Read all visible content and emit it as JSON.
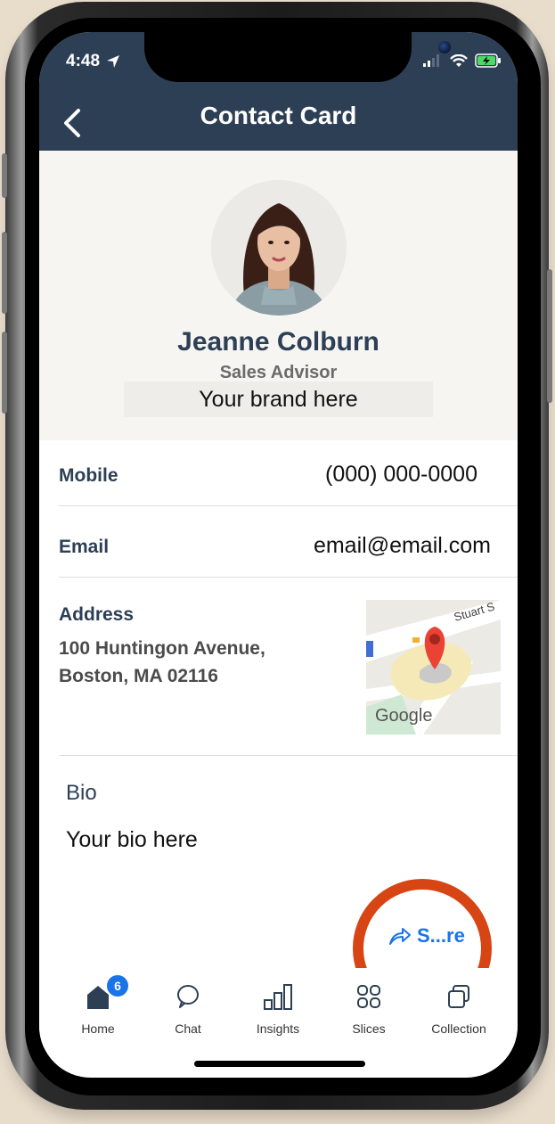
{
  "status_bar": {
    "time": "4:48"
  },
  "header": {
    "title": "Contact Card"
  },
  "profile": {
    "name": "Jeanne Colburn",
    "role": "Sales Advisor",
    "brand": "Your brand here"
  },
  "contact": {
    "mobile_label": "Mobile",
    "mobile_value": "(000) 000-0000",
    "email_label": "Email",
    "email_value": "email@email.com",
    "address_label": "Address",
    "address_line1": "100 Huntingon Avenue,",
    "address_line2": "Boston, MA 02116"
  },
  "map": {
    "street_label": "Stuart S",
    "google_logo": "Google"
  },
  "bio": {
    "label": "Bio",
    "text": "Your bio here"
  },
  "share": {
    "label": "S...re"
  },
  "tabbar": {
    "home_badge": "6",
    "items": [
      {
        "label": "Home",
        "icon": "home-icon"
      },
      {
        "label": "Chat",
        "icon": "chat-icon"
      },
      {
        "label": "Insights",
        "icon": "insights-icon"
      },
      {
        "label": "Slices",
        "icon": "slices-icon"
      },
      {
        "label": "Collection",
        "icon": "collection-icon"
      }
    ]
  },
  "colors": {
    "header_bg": "#2d3f55",
    "accent_blue": "#1a73e8",
    "highlight_circle": "#d64513",
    "background": "#e8dccb"
  }
}
